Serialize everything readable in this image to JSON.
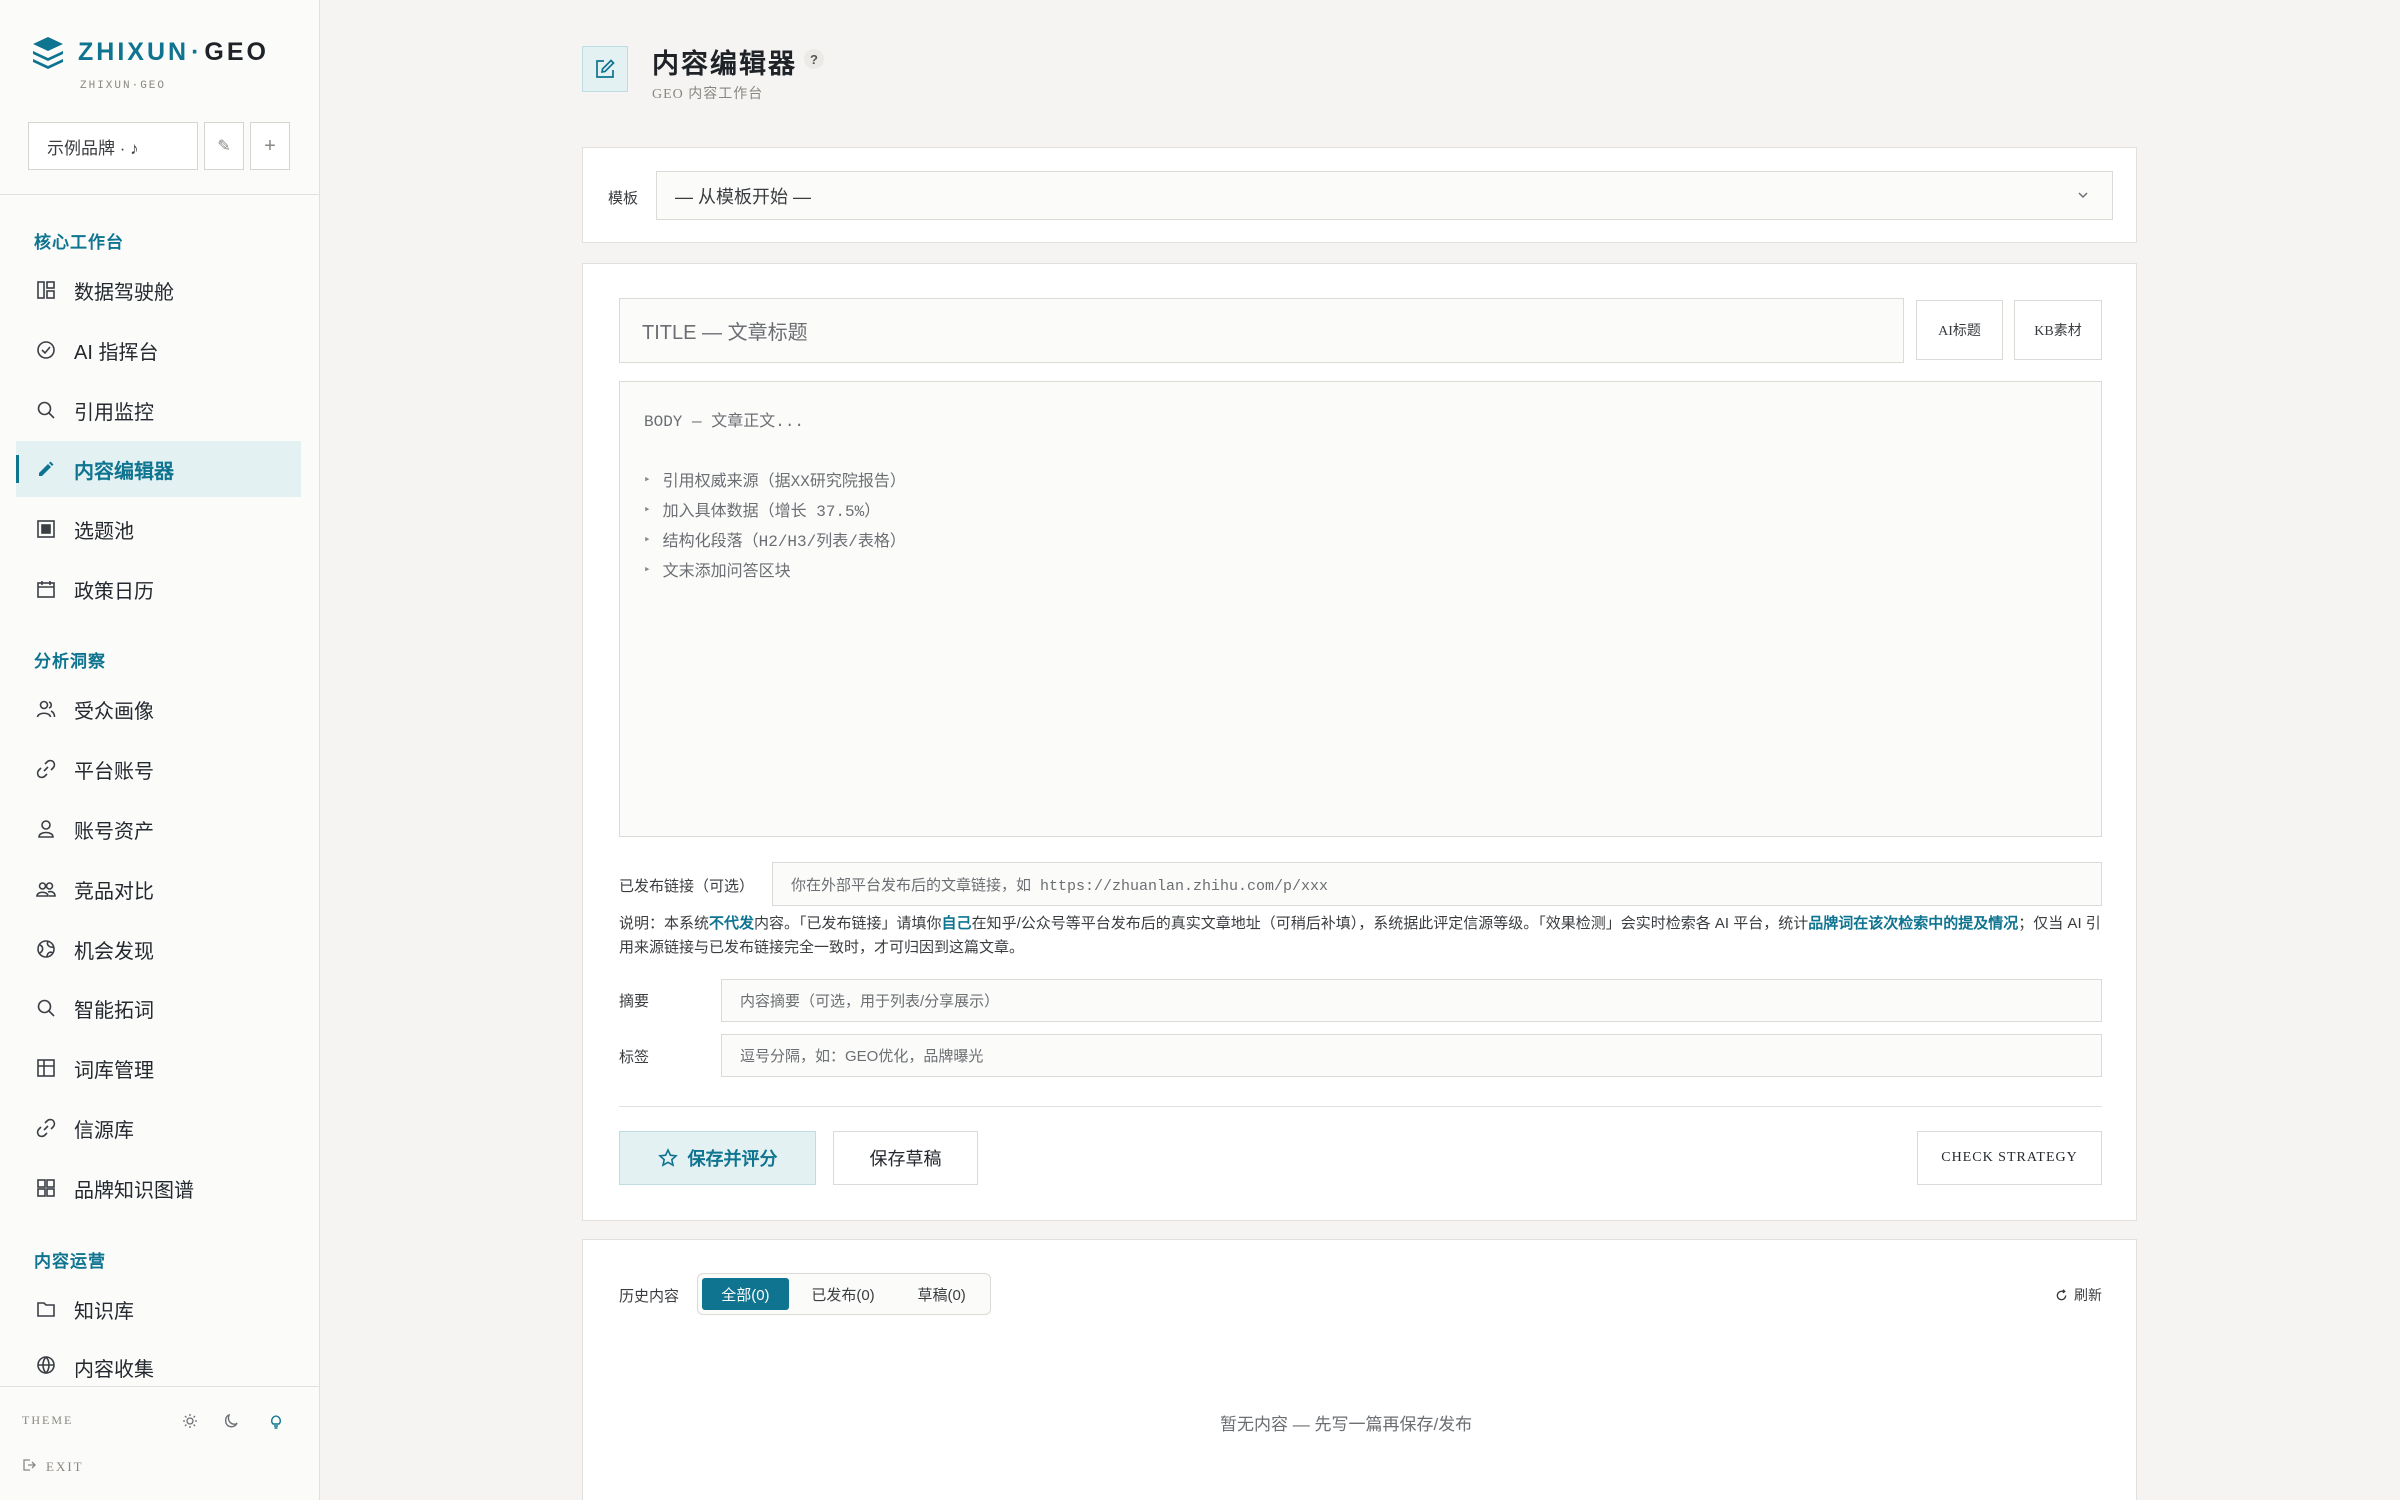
{
  "brand": {
    "name_main": "ZHIXUN",
    "name_dot": "·",
    "name_geo": "GEO",
    "sub": "ZHIXUN·GEO",
    "select_value": "示例品牌 · ♪",
    "edit_glyph": "✎",
    "add_glyph": "+"
  },
  "sidebar": {
    "sections": [
      {
        "label": "核心工作台"
      },
      {
        "label": "分析洞察"
      },
      {
        "label": "内容运营"
      }
    ],
    "items": [
      {
        "label": "数据驾驶舱",
        "icon": "dashboard-icon"
      },
      {
        "label": "AI 指挥台",
        "icon": "check-circle-icon"
      },
      {
        "label": "引用监控",
        "icon": "search-icon"
      },
      {
        "label": "内容编辑器",
        "icon": "pencil-icon",
        "active": true
      },
      {
        "label": "选题池",
        "icon": "list-box-icon"
      },
      {
        "label": "政策日历",
        "icon": "calendar-icon"
      },
      {
        "label": "受众画像",
        "icon": "users-icon"
      },
      {
        "label": "平台账号",
        "icon": "link-icon"
      },
      {
        "label": "账号资产",
        "icon": "user-icon"
      },
      {
        "label": "竞品对比",
        "icon": "group-icon"
      },
      {
        "label": "机会发现",
        "icon": "globe-icon"
      },
      {
        "label": "智能拓词",
        "icon": "search-icon"
      },
      {
        "label": "词库管理",
        "icon": "table-icon"
      },
      {
        "label": "信源库",
        "icon": "link-icon"
      },
      {
        "label": "品牌知识图谱",
        "icon": "grid-icon"
      },
      {
        "label": "知识库",
        "icon": "folder-icon"
      },
      {
        "label": "内容收集",
        "icon": "globe-icon"
      }
    ],
    "theme_label": "THEME",
    "exit_label": "EXIT"
  },
  "header": {
    "title": "内容编辑器",
    "help": "?",
    "subtitle": "GEO 内容工作台"
  },
  "template": {
    "label": "模板",
    "value": "— 从模板开始 —"
  },
  "editor": {
    "title_placeholder": "TITLE — 文章标题",
    "ai_title_button": "AI标题",
    "kb_button": "KB素材",
    "body_placeholder": "BODY — 文章正文...",
    "body_hints": [
      "引用权威来源（据XX研究院报告）",
      "加入具体数据（增长 37.5%）",
      "结构化段落（H2/H3/列表/表格）",
      "文末添加问答区块"
    ],
    "published_link_label": "已发布链接（可选）",
    "published_link_placeholder": "你在外部平台发布后的文章链接，如 https://zhuanlan.zhihu.com/p/xxx",
    "note": {
      "p1": "说明：本系统",
      "b1": "不代发",
      "p2": "内容。「已发布链接」请填你",
      "b2": "自己",
      "p3": "在知乎/公众号等平台发布后的真实文章地址（可稍后补填），系统据此评定信源等级。「效果检测」会实时检索各 AI 平台，统计",
      "b3": "品牌词在该次检索中的提及情况",
      "p4": "；仅当 AI 引用来源链接与已发布链接完全一致时，才可归因到这篇文章。"
    },
    "summary_label": "摘要",
    "summary_placeholder": "内容摘要（可选，用于列表/分享展示）",
    "tags_label": "标签",
    "tags_placeholder": "逗号分隔，如：GEO优化，品牌曝光",
    "save_score_button": "保存并评分",
    "save_draft_button": "保存草稿",
    "check_strategy_button": "CHECK STRATEGY"
  },
  "history": {
    "label": "历史内容",
    "tabs": [
      {
        "label": "全部(0)",
        "active": true
      },
      {
        "label": "已发布(0)"
      },
      {
        "label": "草稿(0)"
      }
    ],
    "refresh": "刷新",
    "empty": "暂无内容 — 先写一篇再保存/发布"
  },
  "colors": {
    "accent": "#0e7490",
    "accent_bg": "#e4f1f3",
    "background": "#f5f4f2"
  }
}
